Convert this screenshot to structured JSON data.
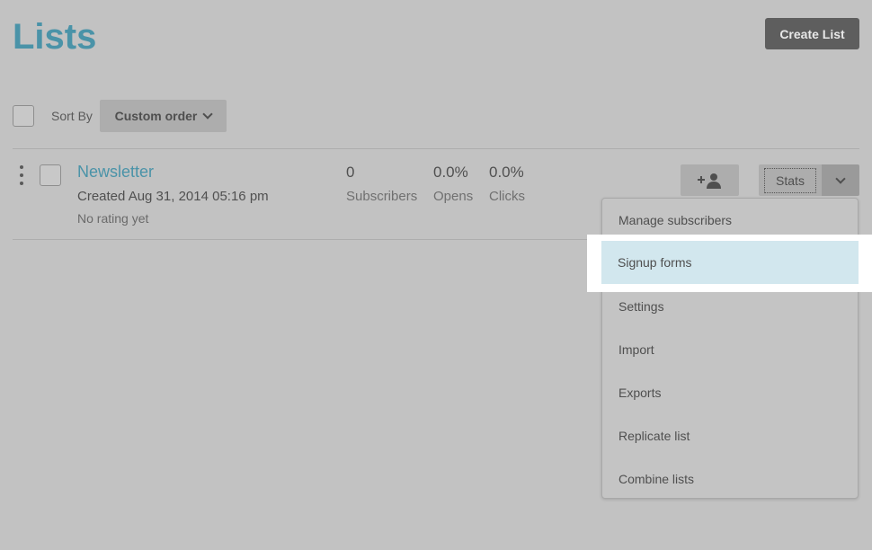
{
  "header": {
    "title": "Lists",
    "create_button": "Create List"
  },
  "toolbar": {
    "sort_label": "Sort By",
    "sort_value": "Custom order"
  },
  "lists": [
    {
      "name": "Newsletter",
      "created": "Created Aug 31, 2014 05:16 pm",
      "rating": "No rating yet",
      "stats": [
        {
          "value": "0",
          "label": "Subscribers"
        },
        {
          "value": "0.0%",
          "label": "Opens"
        },
        {
          "value": "0.0%",
          "label": "Clicks"
        }
      ],
      "stats_button": "Stats"
    }
  ],
  "menu": {
    "items": [
      "Manage subscribers",
      "Signup forms",
      "Settings",
      "Import",
      "Exports",
      "Replicate list",
      "Combine lists"
    ],
    "highlighted": "Signup forms"
  },
  "icons": {
    "add_subscriber": "add-user-icon",
    "caret": "chevron-down-icon",
    "kebab": "drag-handle-icon"
  },
  "colors": {
    "accent": "#4a93a8",
    "highlight": "#d2e7ee"
  }
}
